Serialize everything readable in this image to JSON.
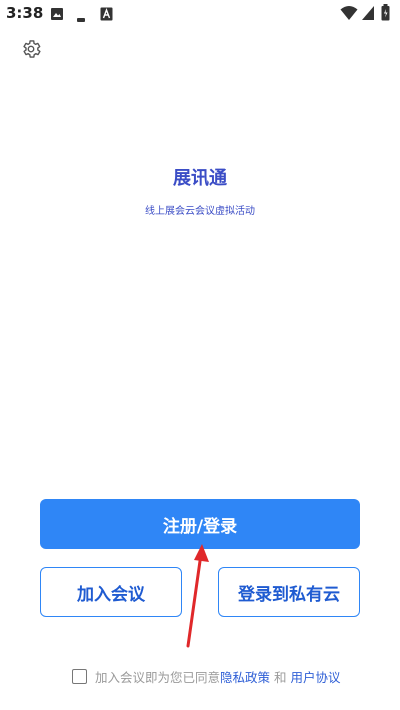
{
  "status_bar": {
    "time": "3:38",
    "icons": [
      "image-icon",
      "minus-icon",
      "a-icon",
      "wifi-icon",
      "signal-icon",
      "battery-icon"
    ]
  },
  "settings": {
    "icon": "gear-icon"
  },
  "brand": {
    "title": "展讯通",
    "subtitle": "线上展会云会议虚拟活动"
  },
  "buttons": {
    "register_login": "注册/登录",
    "join_meeting": "加入会议",
    "login_private_cloud": "登录到私有云"
  },
  "agreement": {
    "prefix": "加入会议即为您已同意",
    "privacy_policy": "隐私政策",
    "and": "和",
    "user_agreement": "用户协议"
  },
  "colors": {
    "primary": "#2f86f6",
    "brand_text": "#3b4dc6",
    "link": "#2f5fd6",
    "annotation_arrow": "#e0282a"
  }
}
